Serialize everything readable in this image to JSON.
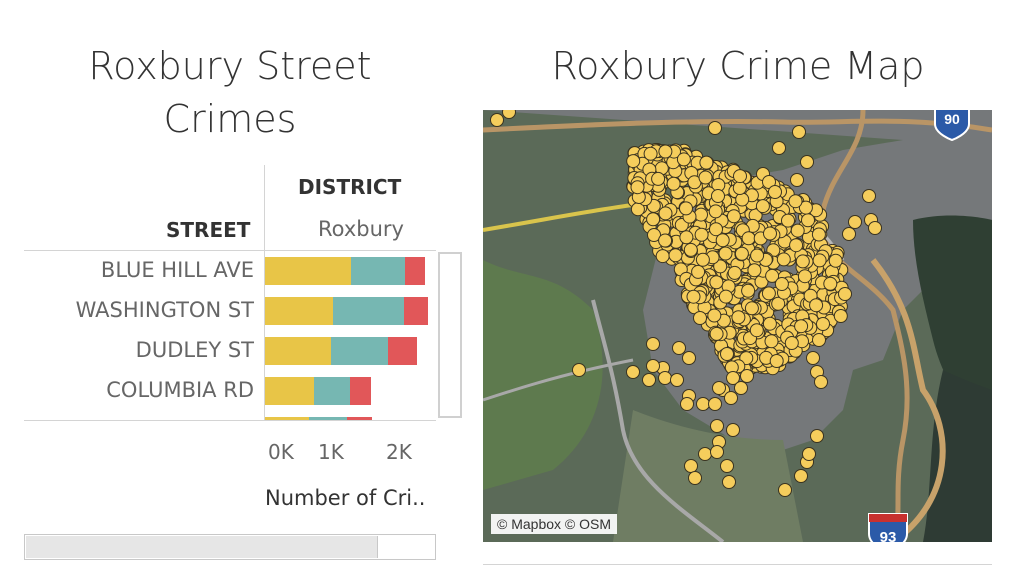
{
  "left_panel": {
    "title": "Roxbury Street Crimes",
    "title_line1": "Roxbury Street",
    "title_line2": "Crimes",
    "column_header": "DISTRICT",
    "column_value": "Roxbury",
    "row_header": "STREET",
    "x_axis_label": "Number of Cri..",
    "x_ticks": [
      "0K",
      "1K",
      "2K"
    ],
    "colors": {
      "yellow": "#e8c547",
      "teal": "#76b7b2",
      "red": "#e15759"
    }
  },
  "chart_data": {
    "type": "bar",
    "orientation": "horizontal",
    "stacked": true,
    "categories": [
      "BLUE HILL AVE",
      "WASHINGTON ST",
      "DUDLEY ST",
      "COLUMBIA RD"
    ],
    "series": [
      {
        "values": [
          1260,
          1000,
          970,
          720
        ],
        "color": "#e8c547"
      },
      {
        "values": [
          800,
          1050,
          840,
          530
        ],
        "color": "#76b7b2"
      },
      {
        "values": [
          300,
          350,
          430,
          310
        ],
        "color": "#e15759"
      }
    ],
    "x_ticks": [
      "0K",
      "1K",
      "2K"
    ],
    "xlim": [
      0,
      2400
    ],
    "xlabel": "Number of Cri..",
    "partial_next_row": [
      650,
      550,
      380
    ]
  },
  "map_panel": {
    "title": "Roxbury Crime Map",
    "attribution": "© Mapbox © OSM",
    "shields": [
      {
        "number": "90",
        "icon": "interstate-90-shield-icon"
      },
      {
        "number": "93",
        "icon": "interstate-93-shield-icon"
      }
    ],
    "marker_color": "#f5cd5c"
  }
}
